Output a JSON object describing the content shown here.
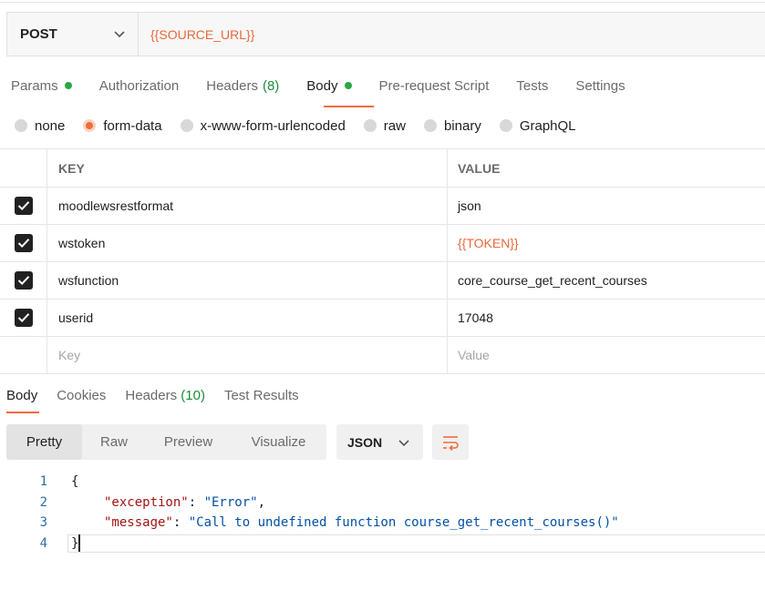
{
  "request": {
    "method": "POST",
    "url": "{{SOURCE_URL}}"
  },
  "request_tabs": [
    {
      "label": "Params",
      "dot": true
    },
    {
      "label": "Authorization"
    },
    {
      "label": "Headers",
      "count": "(8)"
    },
    {
      "label": "Body",
      "dot": true,
      "active": true
    },
    {
      "label": "Pre-request Script"
    },
    {
      "label": "Tests"
    },
    {
      "label": "Settings"
    }
  ],
  "body_types": [
    "none",
    "form-data",
    "x-www-form-urlencoded",
    "raw",
    "binary",
    "GraphQL"
  ],
  "body_type_selected": "form-data",
  "params_table": {
    "headers": {
      "key": "KEY",
      "value": "VALUE"
    },
    "rows": [
      {
        "key": "moodlewsrestformat",
        "value": "json",
        "checked": true
      },
      {
        "key": "wstoken",
        "value": "{{TOKEN}}",
        "checked": true
      },
      {
        "key": "wsfunction",
        "value": "core_course_get_recent_courses",
        "checked": true
      },
      {
        "key": "userid",
        "value": "17048",
        "checked": true
      }
    ],
    "placeholder_key": "Key",
    "placeholder_value": "Value"
  },
  "response_tabs": [
    {
      "label": "Body",
      "active": true
    },
    {
      "label": "Cookies"
    },
    {
      "label": "Headers",
      "count": "(10)"
    },
    {
      "label": "Test Results"
    }
  ],
  "view_modes": [
    "Pretty",
    "Raw",
    "Preview",
    "Visualize"
  ],
  "view_mode_active": "Pretty",
  "format": "JSON",
  "response_lines": [
    {
      "n": "1",
      "text": "{"
    },
    {
      "n": "2",
      "key": "\"exception\"",
      "value": "\"Error\"",
      "trail": ","
    },
    {
      "n": "3",
      "key": "\"message\"",
      "value": "\"Call to undefined function course_get_recent_courses()\"",
      "trail": ""
    },
    {
      "n": "4",
      "text": "}"
    }
  ],
  "colors": {
    "accent": "#f26b3a",
    "variable": "#e8693a",
    "dot": "#28a745",
    "json_key": "#a31515",
    "json_string": "#0451a5"
  }
}
